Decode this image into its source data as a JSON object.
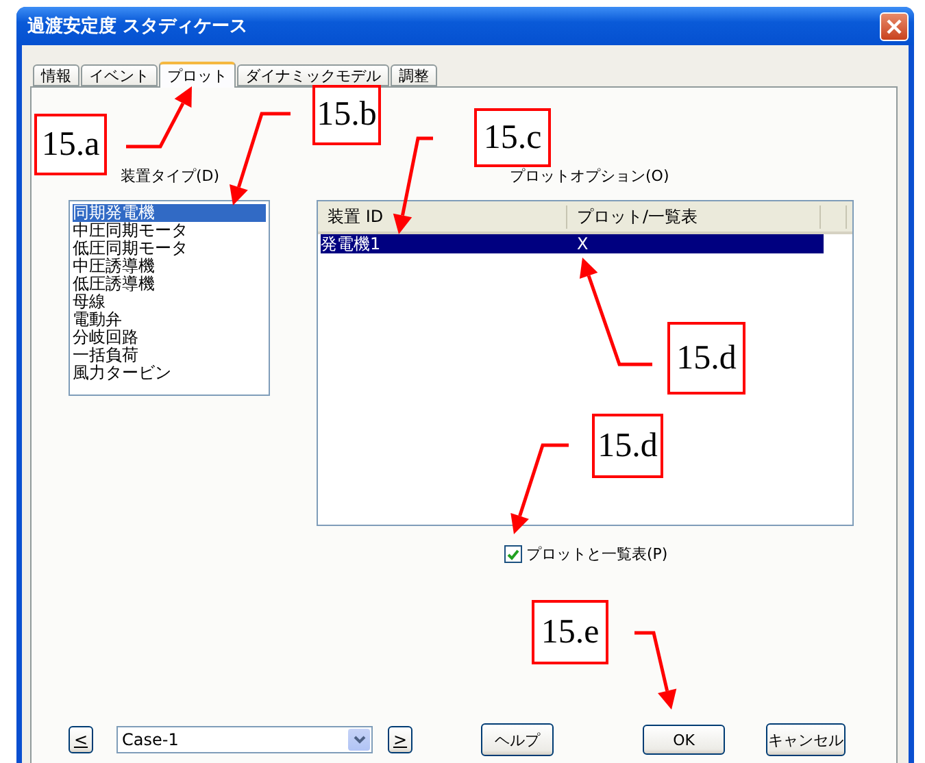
{
  "window": {
    "title": "過渡安定度 スタディケース"
  },
  "tabs": [
    {
      "label": "情報",
      "selected": false
    },
    {
      "label": "イベント",
      "selected": false
    },
    {
      "label": "プロット",
      "selected": true
    },
    {
      "label": "ダイナミックモデル",
      "selected": false
    },
    {
      "label": "調整",
      "selected": false
    }
  ],
  "device_type": {
    "label": "装置タイプ(D)",
    "items": [
      {
        "label": "同期発電機",
        "selected": true
      },
      {
        "label": "中圧同期モータ",
        "selected": false
      },
      {
        "label": "低圧同期モータ",
        "selected": false
      },
      {
        "label": "中圧誘導機",
        "selected": false
      },
      {
        "label": "低圧誘導機",
        "selected": false
      },
      {
        "label": "母線",
        "selected": false
      },
      {
        "label": "電動弁",
        "selected": false
      },
      {
        "label": "分岐回路",
        "selected": false
      },
      {
        "label": "一括負荷",
        "selected": false
      },
      {
        "label": "風力タービン",
        "selected": false
      }
    ]
  },
  "plot_options": {
    "label": "プロットオプション(O)",
    "columns": [
      "装置 ID",
      "プロット/一覧表"
    ],
    "rows": [
      {
        "cells": [
          "発電機1",
          "X"
        ],
        "selected": true
      }
    ]
  },
  "checkbox": {
    "label": "プロットと一覧表(P)",
    "checked": true
  },
  "footer": {
    "prev": "<",
    "case": "Case-1",
    "next": ">",
    "buttons": [
      "ヘルプ",
      "OK",
      "キャンセル"
    ]
  },
  "annotations": [
    {
      "label": "15.a"
    },
    {
      "label": "15.b"
    },
    {
      "label": "15.c"
    },
    {
      "label": "15.d"
    },
    {
      "label": "15.d"
    },
    {
      "label": "15.e"
    }
  ]
}
